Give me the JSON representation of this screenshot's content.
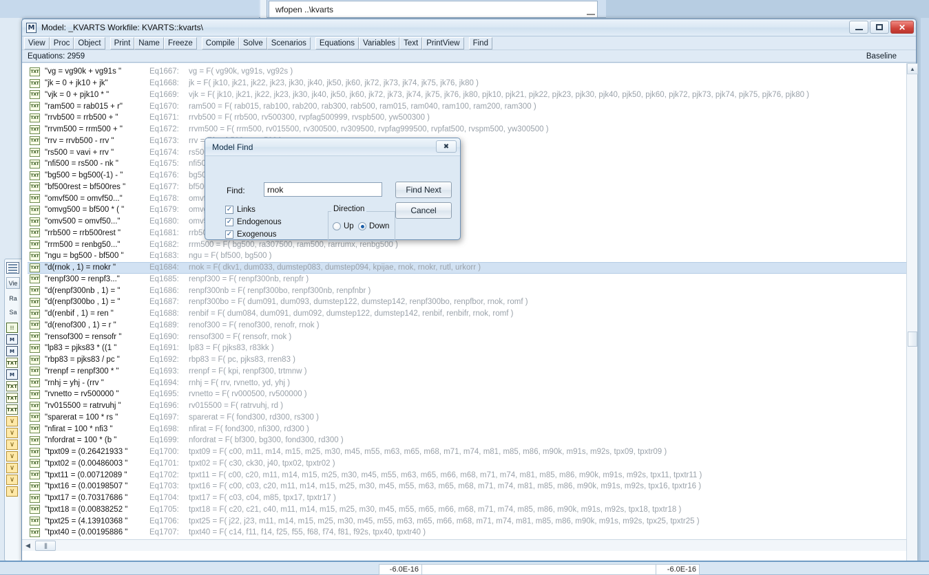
{
  "background": {
    "command_window": {
      "text": "wfopen ..\\kvarts"
    },
    "status_values": {
      "left": "-6.0E-16",
      "right": "-6.0E-16"
    },
    "side_icons": [
      {
        "name": "table-icon",
        "glyph": "▦"
      },
      {
        "name": "view-button",
        "label": "Vie"
      },
      {
        "name": "range-label",
        "label": "Ra"
      },
      {
        "name": "sample-label",
        "label": "Sa"
      },
      {
        "name": "grid-object-icon",
        "glyph": "☷"
      },
      {
        "name": "model-object-icon",
        "glyph": "M"
      },
      {
        "name": "model-object-icon",
        "glyph": "M"
      },
      {
        "name": "text-object-icon",
        "glyph": "TXT"
      },
      {
        "name": "model-object-icon",
        "glyph": "M"
      },
      {
        "name": "text-object-icon",
        "glyph": "TXT"
      },
      {
        "name": "text-object-icon",
        "glyph": "TXT"
      },
      {
        "name": "text-object-icon",
        "glyph": "TXT"
      },
      {
        "name": "series-object-icon",
        "glyph": "∨"
      },
      {
        "name": "series-object-icon",
        "glyph": "∨"
      },
      {
        "name": "series-object-icon",
        "glyph": "∨"
      },
      {
        "name": "series-object-icon",
        "glyph": "∨"
      },
      {
        "name": "series-object-icon",
        "glyph": "∨"
      },
      {
        "name": "series-object-icon",
        "glyph": "∨"
      },
      {
        "name": "series-object-icon",
        "glyph": "∨"
      }
    ]
  },
  "window": {
    "icon_glyph": "M",
    "title": "Model: _KVARTS   Workfile: KVARTS::kvarts\\",
    "buttons": {
      "minimize": "minimize-button",
      "maximize": "maximize-button",
      "close": "✕"
    }
  },
  "toolbar": {
    "groups": [
      [
        "View",
        "Proc",
        "Object"
      ],
      [
        "Print",
        "Name",
        "Freeze"
      ],
      [
        "Compile",
        "Solve",
        "Scenarios"
      ],
      [
        "Equations",
        "Variables",
        "Text",
        "PrintView"
      ],
      [
        "Find"
      ]
    ]
  },
  "infobar": {
    "count_label": "Equations: 2959",
    "scenario_label": "Baseline"
  },
  "list": {
    "icon_glyph": "TXT",
    "selected_index": 17,
    "rows": [
      {
        "name": "\"vg  = vg90k  + vg91s  \"",
        "eq": "Eq1667:",
        "expr": "vg  =  F( vg90k, vg91s, vg92s )"
      },
      {
        "name": "\"jk  = 0  + jk10  + jk\"",
        "eq": "Eq1668:",
        "expr": "jk  =  F( jk10, jk21, jk22, jk23, jk30, jk40, jk50, jk60, jk72, jk73, jk74, jk75, jk76, jk80 )"
      },
      {
        "name": "\"vjk  = 0  + pjk10  * \"",
        "eq": "Eq1669:",
        "expr": "vjk  =  F( jk10, jk21, jk22, jk23, jk30, jk40, jk50, jk60, jk72, jk73, jk74, jk75, jk76, jk80, pjk10, pjk21, pjk22, pjk23, pjk30, pjk40, pjk50, pjk60, pjk72, pjk73, pjk74, pjk75, pjk76, pjk80 )"
      },
      {
        "name": "\"ram500  = rab015  + r\"",
        "eq": "Eq1670:",
        "expr": "ram500  =  F( rab015, rab100, rab200, rab300, rab500, ram015, ram040, ram100, ram200, ram300 )"
      },
      {
        "name": "\"rrvb500  = rrb500  + \"",
        "eq": "Eq1671:",
        "expr": "rrvb500  =  F( rrb500, rv500300, rvpfag500999, rvspb500, yw500300 )"
      },
      {
        "name": "\"rrvm500  = rrm500  + \"",
        "eq": "Eq1672:",
        "expr": "rrvm500  =  F( rrm500, rv015500, rv300500, rv309500, rvpfag999500, rvpfat500, rvspm500, yw300500 )"
      },
      {
        "name": "\"rrv  = rrvb500  - rrv \"",
        "eq": "Eq1673:",
        "expr": "rrv  =  F( rrvb500, rrvm500 )"
      },
      {
        "name": "\"rs500  = vavi  + rrv \"",
        "eq": "Eq1674:",
        "expr": "rs500  =  F( rrv, vavi )"
      },
      {
        "name": "\"nfi500  = rs500  - nk \"",
        "eq": "Eq1675:",
        "expr": "nfi500  =  F( nk, rs500 )"
      },
      {
        "name": "\"bg500  = bg500(-1)  - \"",
        "eq": "Eq1676:",
        "expr": "bg500  =  F( bg500, nfi500 )"
      },
      {
        "name": "\"bf500rest  = bf500res \"",
        "eq": "Eq1677:",
        "expr": "bf500rest  =  F( bf500rest )"
      },
      {
        "name": "\"omvf500  = omvf50...\"",
        "eq": "Eq1678:",
        "expr": "omvf500  =  F( omvf500 )"
      },
      {
        "name": "\"omvg500  = bf500  * ( \"",
        "eq": "Eq1679:",
        "expr": "omvg500  =  F( bf500, omvf500 )"
      },
      {
        "name": "\"omv500  = omvf50...\"",
        "eq": "Eq1680:",
        "expr": "omv500  =  F( omvf500, omvg500 )"
      },
      {
        "name": "\"rrb500  = rrb500rest \"",
        "eq": "Eq1681:",
        "expr": "rrb500  =  F( rrb500rest, rrmspu )"
      },
      {
        "name": "\"rrm500  = renbg50...\"",
        "eq": "Eq1682:",
        "expr": "rrm500  =  F( bg500, ra307500, ram500, rarrumx, renbg500 )"
      },
      {
        "name": "\"ngu  = bg500  - bf500 \"",
        "eq": "Eq1683:",
        "expr": "ngu  =  F( bf500, bg500 )"
      },
      {
        "name": "\"d(rnok  , 1)  = rnokr \"",
        "eq": "Eq1684:",
        "expr": "rnok  =  F( dkv1, dum033, dumstep083, dumstep094, kpijae, rnok, rnokr, rutl, urkorr )"
      },
      {
        "name": "\"renpf300  = renpf3...\"",
        "eq": "Eq1685:",
        "expr": "renpf300  =  F( renpf300nb, renpfr )"
      },
      {
        "name": "\"d(renpf300nb  , 1)  = \"",
        "eq": "Eq1686:",
        "expr": "renpf300nb  =  F( renpf300bo, renpf300nb, renpfnbr )"
      },
      {
        "name": "\"d(renpf300bo  , 1)  = \"",
        "eq": "Eq1687:",
        "expr": "renpf300bo  =  F( dum091, dum093, dumstep122, dumstep142, renpf300bo, renpfbor, rnok, romf )"
      },
      {
        "name": "\"d(renbif  , 1)  = ren \"",
        "eq": "Eq1688:",
        "expr": "renbif  =  F( dum084, dum091, dum092, dumstep122, dumstep142, renbif, renbifr, rnok, romf )"
      },
      {
        "name": "\"d(renof300  , 1)  = r \"",
        "eq": "Eq1689:",
        "expr": "renof300  =  F( renof300, renofr, rnok )"
      },
      {
        "name": "\"rensof300  = rensofr \"",
        "eq": "Eq1690:",
        "expr": "rensof300  =  F( rensofr, rnok )"
      },
      {
        "name": "\"lp83  = pjks83  * ((1 \"",
        "eq": "Eq1691:",
        "expr": "lp83  =  F( pjks83, r83kk )"
      },
      {
        "name": "\"rbp83  = pjks83  / pc \"",
        "eq": "Eq1692:",
        "expr": "rbp83  =  F( pc, pjks83, rren83 )"
      },
      {
        "name": "\"rrenpf  = renpf300  * \"",
        "eq": "Eq1693:",
        "expr": "rrenpf  =  F( kpi, renpf300, trtmnw )"
      },
      {
        "name": "\"rnhj  = yhj  - (rrv   \"",
        "eq": "Eq1694:",
        "expr": "rnhj  =  F( rrv, rvnetto, yd, yhj )"
      },
      {
        "name": "\"rvnetto  = rv500000  \"",
        "eq": "Eq1695:",
        "expr": "rvnetto  =  F( rv000500, rv500000 )"
      },
      {
        "name": "\"rv015500  = ratrvuhj \"",
        "eq": "Eq1696:",
        "expr": "rv015500  =  F( ratrvuhj, rd )"
      },
      {
        "name": "\"sparerat  = 100  * rs \"",
        "eq": "Eq1697:",
        "expr": "sparerat  =  F( fond300, rd300, rs300 )"
      },
      {
        "name": "\"nfirat  = 100  * nfi3 \"",
        "eq": "Eq1698:",
        "expr": "nfirat  =  F( fond300, nfi300, rd300 )"
      },
      {
        "name": "\"nfordrat  = 100  * (b \"",
        "eq": "Eq1699:",
        "expr": "nfordrat  =  F( bf300, bg300, fond300, rd300 )"
      },
      {
        "name": "\"tpxt09  = (0.26421933 \"",
        "eq": "Eq1700:",
        "expr": "tpxt09  =  F( c00, m11, m14, m15, m25, m30, m45, m55, m63, m65, m68, m71, m74, m81, m85, m86, m90k, m91s, m92s, tpx09, tpxtr09 )"
      },
      {
        "name": "\"tpxt02  = (0.00486003 \"",
        "eq": "Eq1701:",
        "expr": "tpxt02  =  F( c30, ck30, j40, tpx02, tpxtr02 )"
      },
      {
        "name": "\"tpxt11  = (0.00712089 \"",
        "eq": "Eq1702:",
        "expr": "tpxt11  =  F( c00, c20, m11, m14, m15, m25, m30, m45, m55, m63, m65, m66, m68, m71, m74, m81, m85, m86, m90k, m91s, m92s, tpx11, tpxtr11 )"
      },
      {
        "name": "\"tpxt16  = (0.00198507 \"",
        "eq": "Eq1703:",
        "expr": "tpxt16  =  F( c00, c03, c20, m11, m14, m15, m25, m30, m45, m55, m63, m65, m68, m71, m74, m81, m85, m86, m90k, m91s, m92s, tpx16, tpxtr16 )"
      },
      {
        "name": "\"tpxt17  = (0.70317686 \"",
        "eq": "Eq1704:",
        "expr": "tpxt17  =  F( c03, c04, m85, tpx17, tpxtr17 )"
      },
      {
        "name": "\"tpxt18  = (0.00838252 \"",
        "eq": "Eq1705:",
        "expr": "tpxt18  =  F( c20, c21, c40, m11, m14, m15, m25, m30, m45, m55, m65, m66, m68, m71, m74, m85, m86, m90k, m91s, m92s, tpx18, tpxtr18 )"
      },
      {
        "name": "\"tpxt25  = (4.13910368 \"",
        "eq": "Eq1706:",
        "expr": "tpxt25  =  F( j22, j23, m11, m14, m15, m25, m30, m45, m55, m63, m65, m66, m68, m71, m74, m81, m85, m86, m90k, m91s, m92s, tpx25, tpxtr25 )"
      },
      {
        "name": "\"tpxt40  = (0.00195886 \"",
        "eq": "Eq1707:",
        "expr": "tpxt40  =  F( c14, f11, f14, f25, f55, f68, f74, f81, f92s, tpx40, tpxtr40 )"
      }
    ]
  },
  "find_dialog": {
    "title": "Model Find",
    "close_glyph": "✖",
    "find_label": "Find:",
    "find_value": "rnok",
    "find_placeholder": "",
    "buttons": {
      "find_next": "Find Next",
      "cancel": "Cancel"
    },
    "checkboxes": [
      {
        "label": "Links",
        "checked": true
      },
      {
        "label": "Endogenous",
        "checked": true
      },
      {
        "label": "Exogenous",
        "checked": true
      }
    ],
    "direction": {
      "legend": "Direction",
      "options": [
        {
          "label": "Up",
          "selected": false
        },
        {
          "label": "Down",
          "selected": true
        }
      ]
    }
  },
  "colors": {
    "selection": "#d2e2f3",
    "accent": "#1c5fa8",
    "window_chrome": "#dce9f5",
    "close_red": "#d0453c",
    "muted_text": "#9aa2aa"
  }
}
